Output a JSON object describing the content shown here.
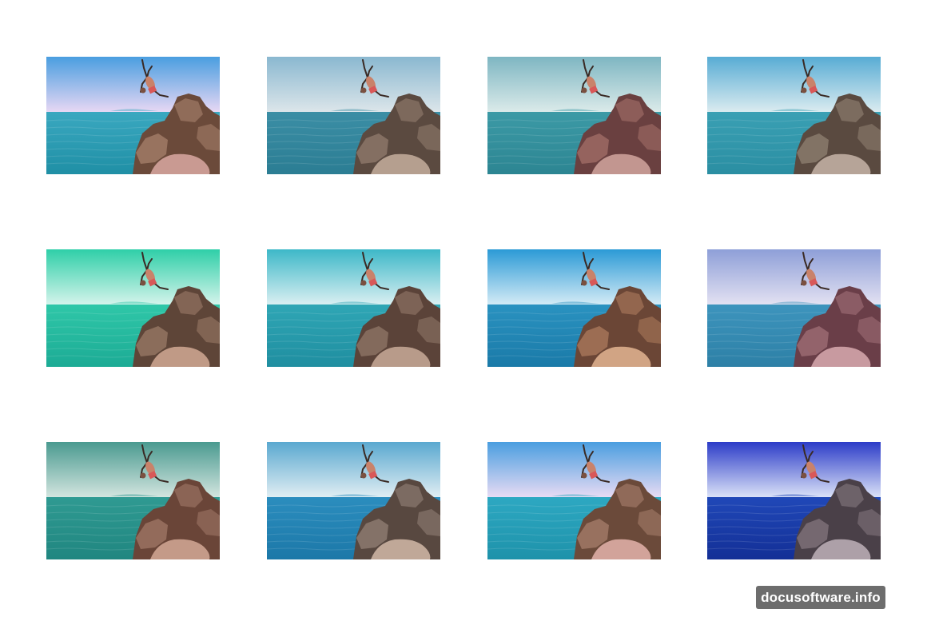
{
  "gallery": {
    "rows": 3,
    "columns": 4,
    "photos": [
      {
        "sky_top": "#4a9ee0",
        "sky_bottom": "#e9d8f4",
        "sea_top": "#3aa8c0",
        "sea_bottom": "#1f8fa5",
        "rock": "#6b4a3a",
        "rock_light": "#a07a66",
        "rock_pink": "#c99a92"
      },
      {
        "sky_top": "#8ab8d0",
        "sky_bottom": "#dde6ea",
        "sea_top": "#3b8ea5",
        "sea_bottom": "#2b7d93",
        "rock": "#5b4a40",
        "rock_light": "#8c7668",
        "rock_pink": "#b59f8f"
      },
      {
        "sky_top": "#7eb6c2",
        "sky_bottom": "#dcebea",
        "sea_top": "#3c9aa6",
        "sea_bottom": "#2c8592",
        "rock": "#6a4040",
        "rock_light": "#9c6a64",
        "rock_pink": "#c29690"
      },
      {
        "sky_top": "#58acd4",
        "sky_bottom": "#dcecf0",
        "sea_top": "#3aa0b4",
        "sea_bottom": "#2a8ea2",
        "rock": "#5a4a40",
        "rock_light": "#8a7a6c",
        "rock_pink": "#b6a498"
      },
      {
        "sky_top": "#2fcfa8",
        "sky_bottom": "#d7f4ec",
        "sea_top": "#2fc7a8",
        "sea_bottom": "#1cab95",
        "rock": "#5e4538",
        "rock_light": "#937462",
        "rock_pink": "#c09a86"
      },
      {
        "sky_top": "#3db8c8",
        "sky_bottom": "#dcf0f2",
        "sea_top": "#2fa6b5",
        "sea_bottom": "#1f8ea0",
        "rock": "#5b4339",
        "rock_light": "#8b7163",
        "rock_pink": "#b89b8a"
      },
      {
        "sky_top": "#2b9ad6",
        "sky_bottom": "#d6ecf6",
        "sea_top": "#2a92c0",
        "sea_bottom": "#1a7aa8",
        "rock": "#6b4636",
        "rock_light": "#a47458",
        "rock_pink": "#d1a484"
      },
      {
        "sky_top": "#8e9fd8",
        "sky_bottom": "#e4e2f2",
        "sea_top": "#3d94bd",
        "sea_bottom": "#2d80a6",
        "rock": "#6a3e48",
        "rock_light": "#9a6a72",
        "rock_pink": "#c89aa0"
      },
      {
        "sky_top": "#4a9a90",
        "sky_bottom": "#d5e6e0",
        "sea_top": "#2f9a92",
        "sea_bottom": "#208680",
        "rock": "#6a4538",
        "rock_light": "#9a7262",
        "rock_pink": "#c49a88"
      },
      {
        "sky_top": "#5aa8d0",
        "sky_bottom": "#e2eef3",
        "sea_top": "#2b8dbe",
        "sea_bottom": "#1c78a8",
        "rock": "#584840",
        "rock_light": "#8c7a70",
        "rock_pink": "#c0a898"
      },
      {
        "sky_top": "#4a9ee0",
        "sky_bottom": "#eadcf4",
        "sea_top": "#2da8c2",
        "sea_bottom": "#1e92aa",
        "rock": "#6b4a3a",
        "rock_light": "#a07866",
        "rock_pink": "#d2a39a"
      },
      {
        "sky_top": "#2c3cc8",
        "sky_bottom": "#dde4f8",
        "sea_top": "#2048b8",
        "sea_bottom": "#132f96",
        "rock": "#4a4048",
        "rock_light": "#7c7078",
        "rock_pink": "#ada0a8"
      }
    ]
  },
  "watermark": {
    "text": "docusoftware.info"
  }
}
